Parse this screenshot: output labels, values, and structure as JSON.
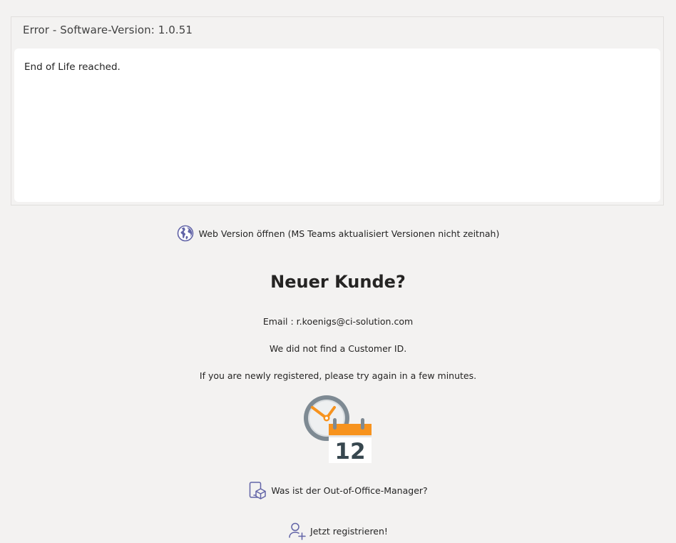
{
  "error": {
    "title": "Error - Software-Version: 1.0.51",
    "message": "End of Life reached."
  },
  "links": {
    "web_version": "Web Version öffnen (MS Teams aktualisiert Versionen nicht zeitnah)",
    "about": "Was ist der Out-of-Office-Manager?",
    "register": "Jetzt registrieren!"
  },
  "new_customer": {
    "heading": "Neuer Kunde?",
    "email_line": "Email : r.koenigs@ci-solution.com",
    "no_customer_id": "We did not find a Customer ID.",
    "retry_hint": "If you are newly registered, please try again in a few minutes."
  },
  "illustration": {
    "calendar_day": "12"
  },
  "icons": {
    "web_version": "globe-icon",
    "about": "tablet-box-icon",
    "register": "add-user-icon",
    "illustration": "clock-calendar-icon"
  },
  "colors": {
    "background": "#f3f2f1",
    "panel_border": "#e1dfdd",
    "accent_purple": "#6264a7",
    "calendar_orange": "#f7931e",
    "clock_grey": "#7e8a93"
  }
}
